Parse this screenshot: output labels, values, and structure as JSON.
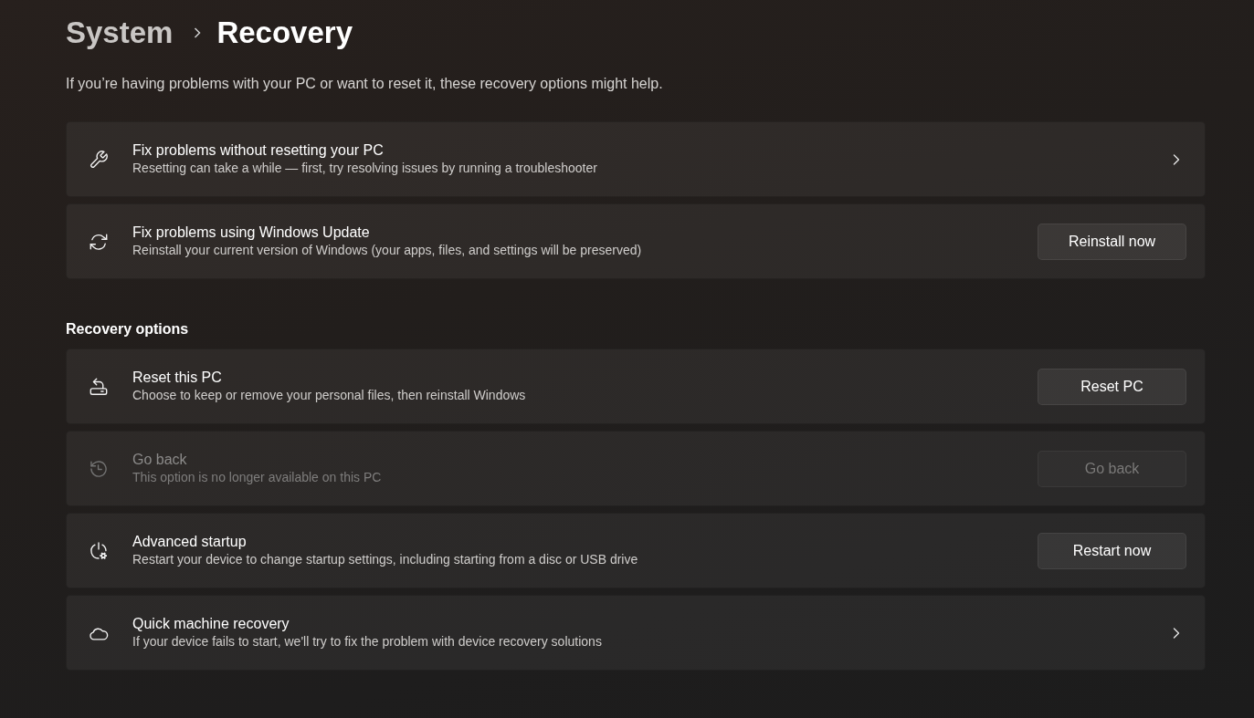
{
  "breadcrumb": {
    "parent": "System",
    "current": "Recovery"
  },
  "description": "If you’re having problems with your PC or want to reset it, these recovery options might help.",
  "groups": [
    {
      "cards": [
        {
          "kind": "link",
          "title": "Fix problems without resetting your PC",
          "subtitle": "Resetting can take a while — first, try resolving issues by running a troubleshooter",
          "disabled": false
        },
        {
          "kind": "button",
          "title": "Fix problems using Windows Update",
          "subtitle": "Reinstall your current version of Windows (your apps, files, and settings will be preserved)",
          "button": "Reinstall now",
          "disabled": false
        }
      ]
    },
    {
      "heading": "Recovery options",
      "cards": [
        {
          "kind": "button",
          "title": "Reset this PC",
          "subtitle": "Choose to keep or remove your personal files, then reinstall Windows",
          "button": "Reset PC",
          "disabled": false
        },
        {
          "kind": "button",
          "title": "Go back",
          "subtitle": "This option is no longer available on this PC",
          "button": "Go back",
          "disabled": true
        },
        {
          "kind": "button",
          "title": "Advanced startup",
          "subtitle": "Restart your device to change startup settings, including starting from a disc or USB drive",
          "button": "Restart now",
          "disabled": false
        },
        {
          "kind": "link",
          "title": "Quick machine recovery",
          "subtitle": "If your device fails to start, we'll try to fix the problem with device recovery solutions",
          "disabled": false
        }
      ]
    }
  ]
}
